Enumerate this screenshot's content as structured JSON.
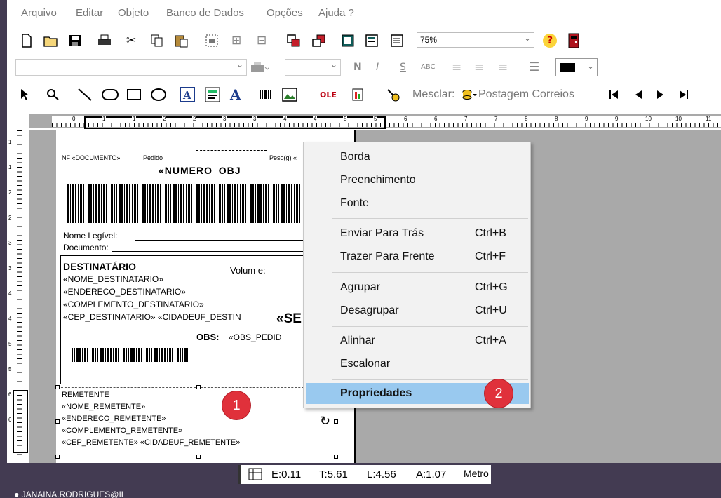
{
  "menu": {
    "items": [
      "Arquivo",
      "Editar",
      "Objeto",
      "Banco de Dados",
      "Opções",
      "Ajuda ?"
    ]
  },
  "toolbar1": {
    "zoom_value": "75%"
  },
  "toolbar3": {
    "mesclar_label": "Mesclar:",
    "postagem_label": "Postagem Correios"
  },
  "ruler": {
    "h_labels": [
      "0",
      "1",
      "1",
      "2",
      "2",
      "3",
      "3",
      "4",
      "4",
      "5",
      "5",
      "6",
      "6",
      "7",
      "7",
      "8",
      "8",
      "9",
      "9",
      "10",
      "10",
      "11"
    ],
    "v_labels": [
      "1",
      "1",
      "2",
      "2",
      "3",
      "3",
      "4",
      "4",
      "5",
      "5",
      "6",
      "6"
    ]
  },
  "document": {
    "nf_label": "NF «DOCUMENTO»",
    "pedido_label": "Pedido",
    "peso_label": "Peso(g) «",
    "numero_obj": "«NUMERO_OBJ",
    "nome_legivel": "Nome Legível:",
    "documento": "Documento:",
    "destinatario_title": "DESTINATÁRIO",
    "volume": "Volum e:",
    "dest_lines": [
      "«NOME_DESTINATARIO»",
      "«ENDERECO_DESTINATARIO»",
      "«COMPLEMENTO_DESTINATARIO»",
      "«CEP_DESTINATARIO» «CIDADEUF_DESTIN"
    ],
    "se_fragment": "«SE",
    "obs_label": "OBS:",
    "obs_value": "«OBS_PEDID",
    "remetente_title": "REMETENTE",
    "rem_lines": [
      "«NOME_REMETENTE»",
      "«ENDERECO_REMETENTE»",
      "«COMPLEMENTO_REMETENTE»",
      "«CEP_REMETENTE» «CIDADEUF_REMETENTE»"
    ]
  },
  "context_menu": {
    "items": [
      {
        "label": "Borda",
        "shortcut": ""
      },
      {
        "label": "Preenchimento",
        "shortcut": ""
      },
      {
        "label": "Fonte",
        "shortcut": ""
      },
      {
        "label": "Enviar Para Trás",
        "shortcut": "Ctrl+B"
      },
      {
        "label": "Trazer Para Frente",
        "shortcut": "Ctrl+F"
      },
      {
        "label": "Agrupar",
        "shortcut": "Ctrl+G"
      },
      {
        "label": "Desagrupar",
        "shortcut": "Ctrl+U"
      },
      {
        "label": "Alinhar",
        "shortcut": "Ctrl+A"
      },
      {
        "label": "Escalonar",
        "shortcut": ""
      },
      {
        "label": "Propriedades",
        "shortcut": ""
      }
    ]
  },
  "badges": [
    "1",
    "2"
  ],
  "status": {
    "e": "E:0.11",
    "t": "T:5.61",
    "l": "L:4.56",
    "a": "A:1.07",
    "unit": "Metro"
  },
  "user": "JANAINA.RODRIGUES@IL",
  "colors": {
    "chrome_dark": "#433b52",
    "workspace_gray": "#a9a9a9",
    "menu_highlight": "#99c9ef",
    "badge_red": "#e0313b"
  }
}
